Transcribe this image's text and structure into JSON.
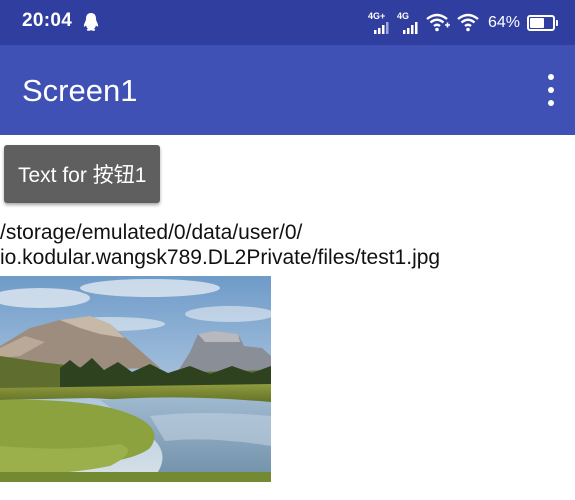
{
  "status_bar": {
    "time": "20:04",
    "signal_1_label": "4G+",
    "signal_2_label": "4G",
    "battery_text": "64%",
    "battery_level": 0.64,
    "icons": [
      "qq-penguin-icon",
      "signal-4g-plus-icon",
      "signal-4g-icon",
      "wifi-plus-icon",
      "wifi-icon",
      "battery-icon"
    ]
  },
  "app_bar": {
    "title": "Screen1",
    "menu_icon": "more-vert-icon"
  },
  "main": {
    "button_label": "Text for 按钮1",
    "path_line_1": "/storage/emulated/0/data/user/0/",
    "path_line_2": "io.kodular.wangsk789.DL2Private/files/test1.jpg",
    "image": "landscape-photo-mountains-river"
  },
  "colors": {
    "status_bar": "#303f9f",
    "app_bar": "#3f51b5",
    "button": "#5f5f5f",
    "background": "#ffffff"
  }
}
